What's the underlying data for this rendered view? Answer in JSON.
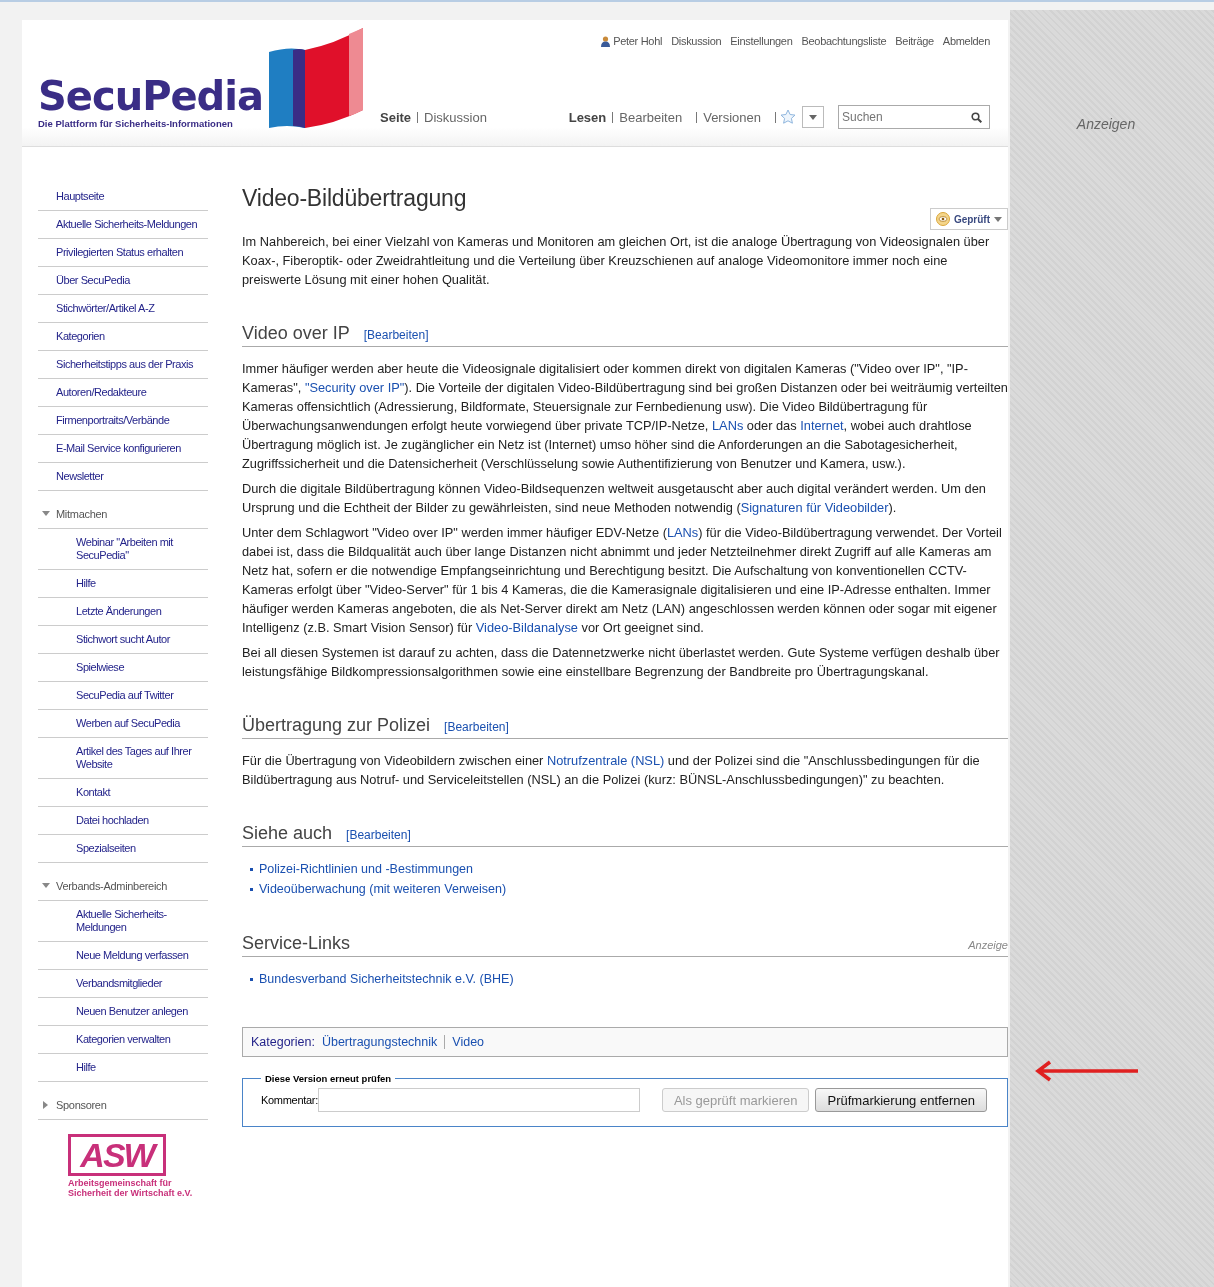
{
  "header": {
    "logo": {
      "name": "SecuPedia",
      "tagline": "Die Plattform für Sicherheits-Informationen"
    },
    "personal": [
      {
        "label": "Peter Hohl",
        "kind": "user"
      },
      {
        "label": "Diskussion",
        "kind": "link"
      },
      {
        "label": "Einstellungen",
        "kind": "link"
      },
      {
        "label": "Beobachtungsliste",
        "kind": "link"
      },
      {
        "label": "Beiträge",
        "kind": "link"
      },
      {
        "label": "Abmelden",
        "kind": "link"
      }
    ],
    "namespaces": [
      {
        "label": "Seite",
        "selected": true
      },
      {
        "label": "Diskussion",
        "selected": false
      }
    ],
    "views": [
      {
        "label": "Lesen",
        "selected": true
      },
      {
        "label": "Bearbeiten",
        "selected": false
      },
      {
        "label": "Versionen",
        "selected": false
      }
    ],
    "search": {
      "placeholder": "Suchen"
    }
  },
  "ad_label": "Anzeigen",
  "sidebar": [
    {
      "kind": "plain",
      "items": [
        {
          "label": "Hauptseite"
        },
        {
          "label": "Aktuelle Sicherheits-Meldungen"
        },
        {
          "label": "Privilegierten Status erhalten"
        },
        {
          "label": "Über SecuPedia"
        },
        {
          "label": "Stichwörter/Artikel A-Z"
        },
        {
          "label": "Kategorien"
        },
        {
          "label": "Sicherheitstipps aus der Praxis"
        },
        {
          "label": "Autoren/Redakteure"
        },
        {
          "label": "Firmenportraits/Verbände"
        },
        {
          "label": "E-Mail Service konfigurieren"
        },
        {
          "label": "Newsletter"
        }
      ]
    },
    {
      "kind": "portal",
      "title": "Mitmachen",
      "expanded": true,
      "items": [
        {
          "label": "Webinar \"Arbeiten mit SecuPedia\""
        },
        {
          "label": "Hilfe"
        },
        {
          "label": "Letzte Änderungen"
        },
        {
          "label": "Stichwort sucht Autor"
        },
        {
          "label": "Spielwiese"
        },
        {
          "label": "SecuPedia auf Twitter"
        },
        {
          "label": "Werben auf SecuPedia"
        },
        {
          "label": "Artikel des Tages auf Ihrer Website"
        },
        {
          "label": "Kontakt"
        },
        {
          "label": "Datei hochladen"
        },
        {
          "label": "Spezialseiten"
        }
      ]
    },
    {
      "kind": "portal",
      "title": "Verbands-Adminbereich",
      "expanded": true,
      "items": [
        {
          "label": "Aktuelle Sicherheits-Meldungen"
        },
        {
          "label": "Neue Meldung verfassen"
        },
        {
          "label": "Verbandsmitglieder"
        },
        {
          "label": "Neuen Benutzer anlegen"
        },
        {
          "label": "Kategorien verwalten"
        },
        {
          "label": "Hilfe"
        }
      ]
    },
    {
      "kind": "portal",
      "title": "Sponsoren",
      "expanded": false
    }
  ],
  "sponsor_logo": {
    "name": "ASW",
    "caption": "Arbeitsgemeinschaft für Sicherheit der Wirtschaft e.V."
  },
  "article": {
    "title": "Video-Bildübertragung",
    "review_badge": "Geprüft",
    "intro": [
      [
        {
          "kind": "text",
          "text": "Im Nahbereich, bei einer Vielzahl von Kameras und Monitoren am gleichen Ort, ist die analoge Übertragung von Videosignalen über Koax-, Fiberoptik- oder Zweidrahtleitung und die Verteilung über Kreuzschienen auf analoge Videomonitore immer noch eine preiswerte Lösung mit einer hohen Qualität."
        }
      ]
    ],
    "sections": [
      {
        "heading": "Video over IP",
        "edit": "[Bearbeiten]",
        "kind": "paragraphs",
        "paragraphs": [
          [
            {
              "kind": "text",
              "text": "Immer häufiger werden aber heute die Videosignale digitalisiert oder kommen direkt von digitalen Kameras (\"Video over IP\", \"IP-Kameras\", "
            },
            {
              "kind": "link",
              "text": "\"Security over IP\""
            },
            {
              "kind": "text",
              "text": "). Die Vorteile der digitalen Video-Bildübertragung sind bei großen Distanzen oder bei weiträumig verteilten Kameras offensichtlich (Adressierung, Bildformate, Steuersignale zur Fernbedienung usw). Die Video Bildübertragung für Überwachungsanwendungen erfolgt heute vorwiegend über private TCP/IP-Netze, "
            },
            {
              "kind": "link",
              "text": "LANs"
            },
            {
              "kind": "text",
              "text": " oder das "
            },
            {
              "kind": "link",
              "text": "Internet"
            },
            {
              "kind": "text",
              "text": ", wobei auch drahtlose Übertragung möglich ist. Je zugänglicher ein Netz ist (Internet) umso höher sind die Anforderungen an die Sabotagesicherheit, Zugriffssicherheit und die Datensicherheit (Verschlüsselung sowie Authentifizierung von Benutzer und Kamera, usw.)."
            }
          ],
          [
            {
              "kind": "text",
              "text": "Durch die digitale Bildübertragung können Video-Bildsequenzen weltweit ausgetauscht aber auch digital verändert werden. Um den Ursprung und die Echtheit der Bilder zu gewährleisten, sind neue Methoden notwendig ("
            },
            {
              "kind": "link",
              "text": "Signaturen für Videobilder"
            },
            {
              "kind": "text",
              "text": ")."
            }
          ],
          [
            {
              "kind": "text",
              "text": "Unter dem Schlagwort \"Video over IP\" werden immer häufiger EDV-Netze ("
            },
            {
              "kind": "link",
              "text": "LANs"
            },
            {
              "kind": "text",
              "text": ") für die Video-Bildübertragung verwendet. Der Vorteil dabei ist, dass die Bildqualität auch über lange Distanzen nicht abnimmt und jeder Netzteilnehmer direkt Zugriff auf alle Kameras am Netz hat, sofern er die notwendige Empfangseinrichtung und Berechtigung besitzt. Die Aufschaltung von konventionellen CCTV-Kameras erfolgt über \"Video-Server\" für 1 bis 4 Kameras, die die Kamerasignale digitalisieren und eine IP-Adresse enthalten. Immer häufiger werden Kameras angeboten, die als Net-Server direkt am Netz (LAN) angeschlossen werden können oder sogar mit eigener Intelligenz (z.B. Smart Vision Sensor) für "
            },
            {
              "kind": "link",
              "text": "Video-Bildanalyse"
            },
            {
              "kind": "text",
              "text": " vor Ort geeignet sind."
            }
          ],
          [
            {
              "kind": "text",
              "text": "Bei all diesen Systemen ist darauf zu achten, dass die Datennetzwerke nicht überlastet werden. Gute Systeme verfügen deshalb über leistungsfähige Bildkompressionsalgorithmen sowie eine einstellbare Begrenzung der Bandbreite pro Übertragungskanal."
            }
          ]
        ]
      },
      {
        "heading": "Übertragung zur Polizei",
        "edit": "[Bearbeiten]",
        "kind": "paragraphs",
        "paragraphs": [
          [
            {
              "kind": "text",
              "text": "Für die Übertragung von Videobildern zwischen einer "
            },
            {
              "kind": "link",
              "text": "Notrufzentrale (NSL)"
            },
            {
              "kind": "text",
              "text": " und der Polizei sind die \"Anschlussbedingungen für die Bildübertragung aus Notruf- und Serviceleitstellen (NSL) an die Polizei (kurz: BÜNSL-Anschlussbedingungen)\" zu beachten."
            }
          ]
        ]
      },
      {
        "heading": "Siehe auch",
        "edit": "[Bearbeiten]",
        "kind": "list",
        "items": [
          "Polizei-Richtlinien und -Bestimmungen",
          "Videoüberwachung (mit weiteren Verweisen)"
        ]
      },
      {
        "heading": "Service-Links",
        "note": "Anzeige",
        "kind": "list",
        "items": [
          "Bundesverband Sicherheitstechnik e.V. (BHE)"
        ]
      }
    ],
    "categories": {
      "label": "Kategorien:",
      "items": [
        "Übertragungstechnik",
        "Video"
      ]
    },
    "review_form": {
      "legend": "Diese Version erneut prüfen",
      "comment_label": "Kommentar:",
      "buttons": [
        {
          "label": "Als geprüft markieren",
          "disabled": true
        },
        {
          "label": "Prüfmarkierung entfernen",
          "disabled": false
        }
      ]
    }
  }
}
